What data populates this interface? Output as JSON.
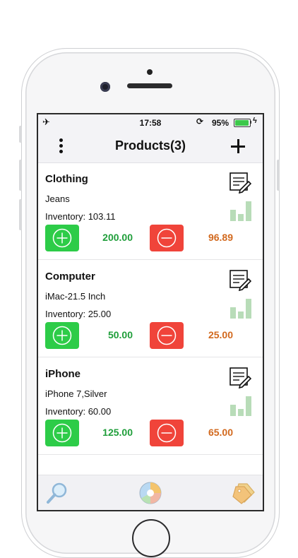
{
  "status_bar": {
    "time": "17:58",
    "battery_text": "95%",
    "battery_level": 0.95,
    "icons": [
      "airplane-icon",
      "orientation-lock-icon",
      "battery-icon",
      "charging-icon"
    ]
  },
  "nav": {
    "title": "Products(3)",
    "left_icon": "more-vertical-icon",
    "right_icon": "plus-icon"
  },
  "products": [
    {
      "category": "Clothing",
      "name": "Jeans",
      "inventory": "Inventory: 103.11",
      "in_amount": "200.00",
      "out_amount": "96.89"
    },
    {
      "category": "Computer",
      "name": "iMac-21.5 Inch",
      "inventory": "Inventory: 25.00",
      "in_amount": "50.00",
      "out_amount": "25.00"
    },
    {
      "category": "iPhone",
      "name": "iPhone 7,Silver",
      "inventory": "Inventory: 60.00",
      "in_amount": "125.00",
      "out_amount": "65.00"
    }
  ],
  "colors": {
    "stock_in": "#2dcc48",
    "stock_out": "#f0443a",
    "in_text": "#1f9e3a",
    "out_text": "#d2691e"
  },
  "tabs": [
    {
      "icon": "magnifier-icon"
    },
    {
      "icon": "pie-chart-icon"
    },
    {
      "icon": "tags-icon"
    }
  ]
}
